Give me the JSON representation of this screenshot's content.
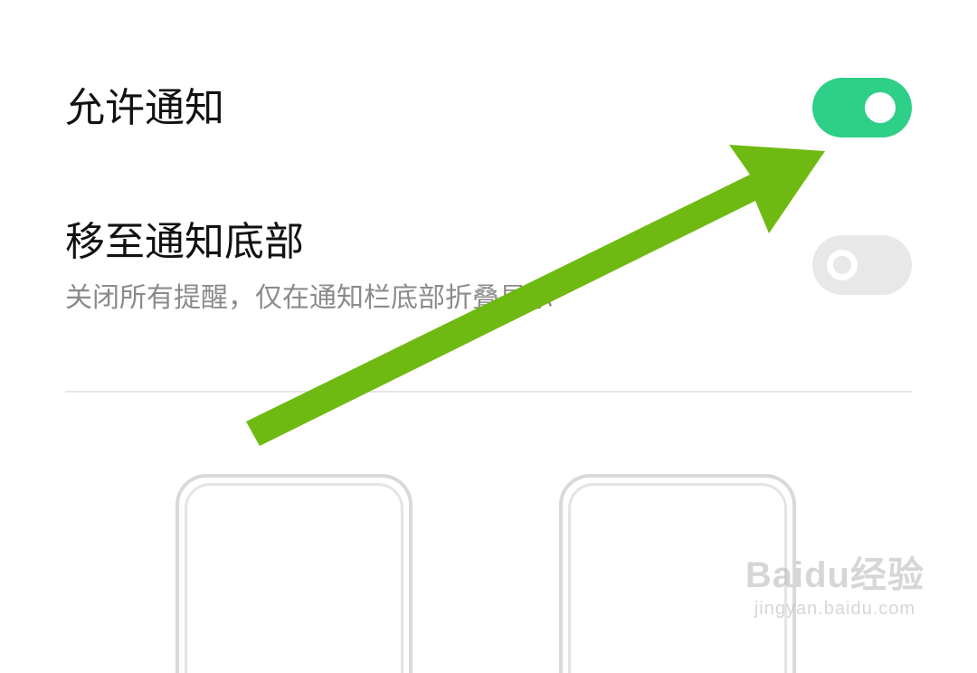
{
  "settings": {
    "allow_notifications": {
      "title": "允许通知",
      "enabled": true
    },
    "move_to_bottom": {
      "title": "移至通知底部",
      "description": "关闭所有提醒，仅在通知栏底部折叠显示",
      "enabled": false
    }
  },
  "colors": {
    "toggle_on": "#2ecf86",
    "toggle_off": "#e8e8e8",
    "annotation_arrow": "#6fba12"
  },
  "annotation": {
    "icon": "arrow-icon"
  },
  "watermark": {
    "brand": "Baidu经验",
    "url": "jingyan.baidu.com"
  }
}
